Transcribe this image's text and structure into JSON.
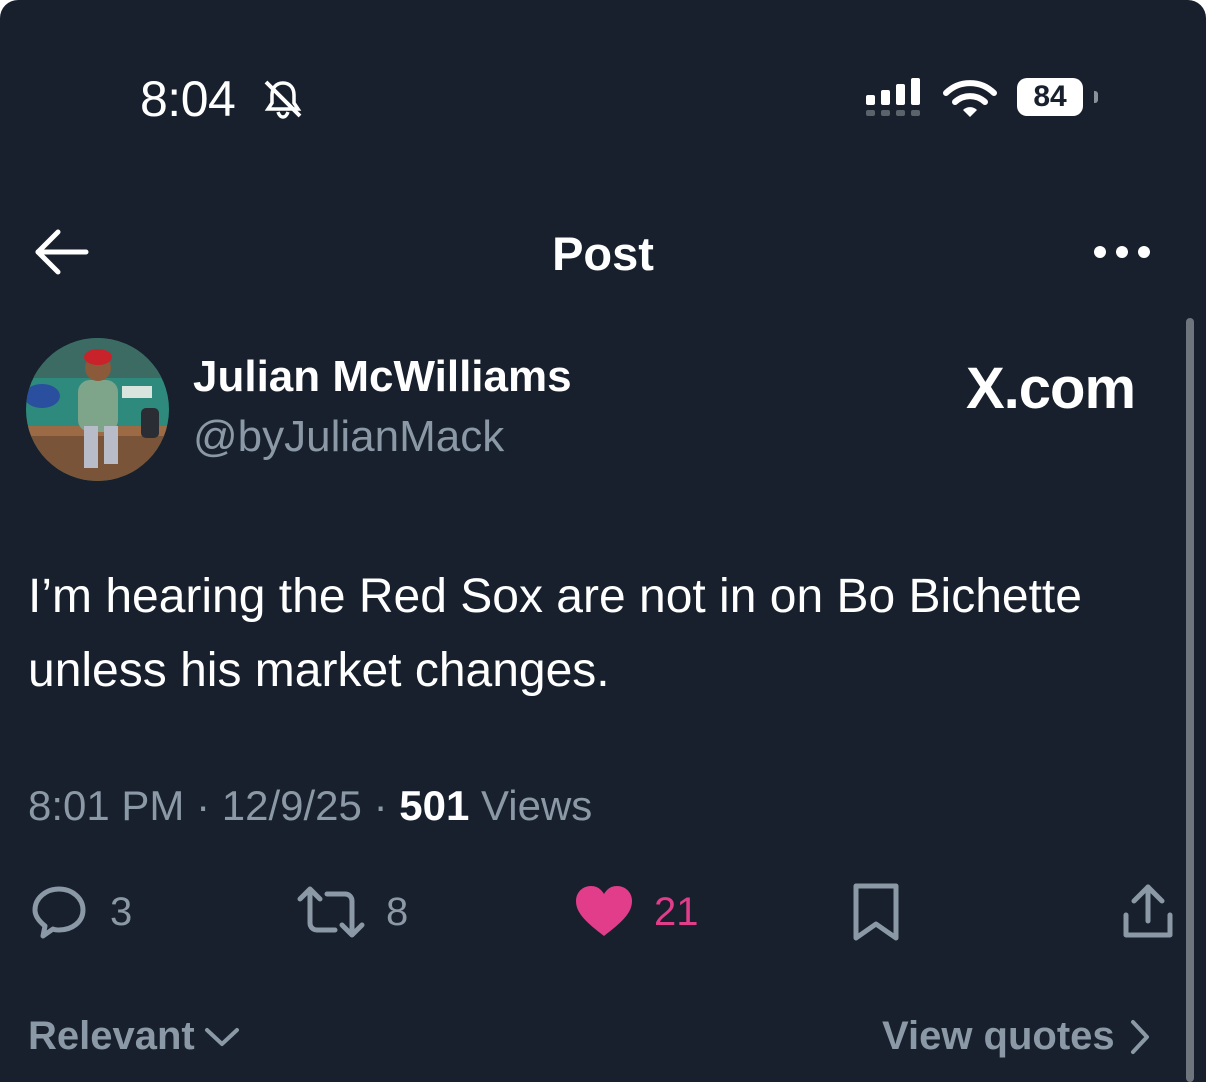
{
  "status_bar": {
    "time": "8:04",
    "battery": "84"
  },
  "header": {
    "title": "Post"
  },
  "author": {
    "name": "Julian McWilliams",
    "handle": "@byJulianMack"
  },
  "brand": "X.com",
  "tweet": {
    "text": "I’m hearing the Red Sox are not in on Bo Bichette unless his market changes."
  },
  "meta": {
    "time": "8:01 PM",
    "sep": "·",
    "date": "12/9/25",
    "views_count": "501",
    "views_label": "Views"
  },
  "actions": {
    "replies": "3",
    "reposts": "8",
    "likes": "21"
  },
  "footer": {
    "sort_label": "Relevant",
    "quotes_label": "View quotes"
  },
  "colors": {
    "background": "#17202c",
    "like": "#e23d8b",
    "muted": "#8b98a5"
  }
}
